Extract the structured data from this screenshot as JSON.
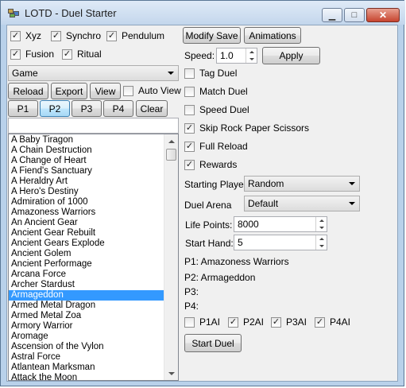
{
  "window": {
    "title": "LOTD - Duel Starter",
    "minimize_glyph": "▁",
    "maximize_glyph": "□",
    "close_glyph": "✕"
  },
  "filters": [
    {
      "label": "Xyz",
      "checked": true
    },
    {
      "label": "Synchro",
      "checked": true
    },
    {
      "label": "Pendulum",
      "checked": true
    },
    {
      "label": "Fusion",
      "checked": true
    },
    {
      "label": "Ritual",
      "checked": true
    }
  ],
  "source_combo": {
    "value": "Game"
  },
  "buttons": {
    "reload": "Reload",
    "export": "Export",
    "view": "View",
    "p1": "P1",
    "p2": "P2",
    "p3": "P3",
    "p4": "P4",
    "clear": "Clear",
    "modify_save": "Modify Save",
    "animations": "Animations",
    "apply": "Apply",
    "start_duel": "Start Duel"
  },
  "auto_view": {
    "label": "Auto View",
    "checked": false
  },
  "search": {
    "value": ""
  },
  "deck_list": {
    "selected": "Armageddon",
    "items": [
      "A Baby Tiragon",
      "A Chain Destruction",
      "A Change of Heart",
      "A Fiend's Sanctuary",
      "A Heraldry Art",
      "A Hero's Destiny",
      "Admiration of 1000",
      "Amazoness Warriors",
      "An Ancient Gear",
      "Ancient Gear Rebuilt",
      "Ancient Gears Explode",
      "Ancient Golem",
      "Ancient Performage",
      "Arcana Force",
      "Archer Stardust",
      "Armageddon",
      "Armed Metal Dragon",
      "Armed Metal Zoa",
      "Armory Warrior",
      "Aromage",
      "Ascension of the Vylon",
      "Astral Force",
      "Atlantean Marksman",
      "Attack the Moon"
    ]
  },
  "speed": {
    "label": "Speed:",
    "value": "1.0"
  },
  "options": [
    {
      "label": "Tag Duel",
      "checked": false
    },
    {
      "label": "Match Duel",
      "checked": false
    },
    {
      "label": "Speed Duel",
      "checked": false
    },
    {
      "label": "Skip Rock Paper Scissors",
      "checked": true
    },
    {
      "label": "Full Reload",
      "checked": true
    },
    {
      "label": "Rewards",
      "checked": true
    }
  ],
  "starting_player": {
    "label": "Starting Player",
    "value": "Random"
  },
  "duel_arena": {
    "label": "Duel Arena",
    "value": "Default"
  },
  "life_points": {
    "label": "Life Points:",
    "value": "8000"
  },
  "start_hand": {
    "label": "Start Hand:",
    "value": "5"
  },
  "players": [
    {
      "label": "P1: Amazoness Warriors"
    },
    {
      "label": "P2: Armageddon"
    },
    {
      "label": "P3:"
    },
    {
      "label": "P4:"
    }
  ],
  "ai_toggles": [
    {
      "label": "P1AI",
      "checked": false
    },
    {
      "label": "P2AI",
      "checked": true
    },
    {
      "label": "P3AI",
      "checked": true
    },
    {
      "label": "P4AI",
      "checked": true
    }
  ]
}
